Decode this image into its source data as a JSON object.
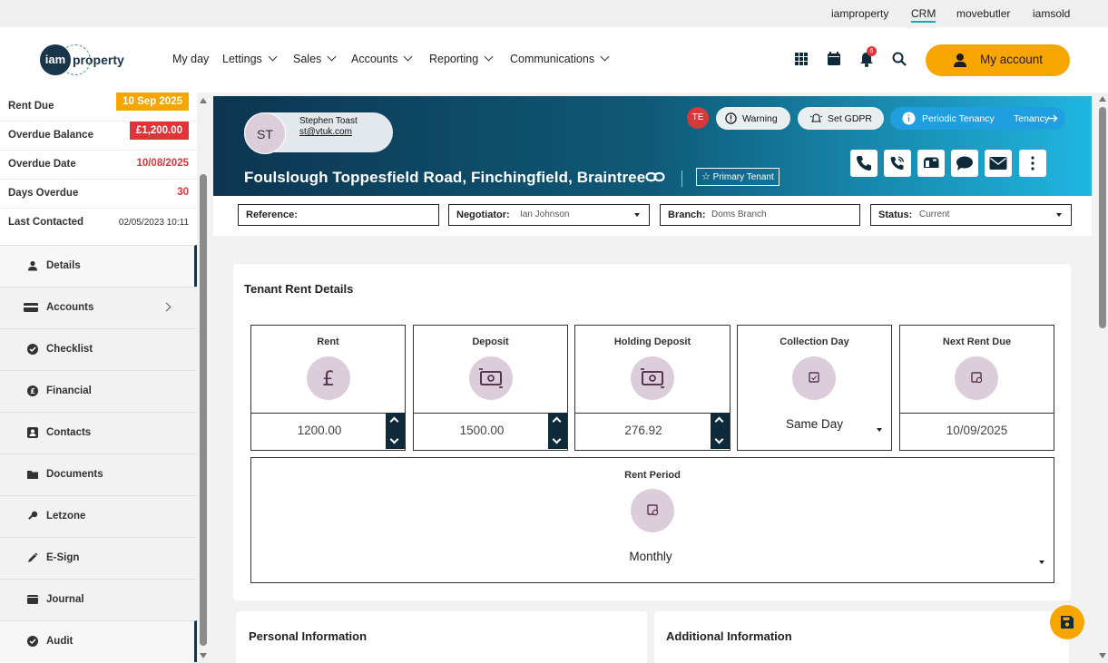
{
  "top_links": [
    "iamproperty",
    "CRM",
    "movebutler",
    "iamsold"
  ],
  "top_links_active": "CRM",
  "logo": {
    "mark": "iam",
    "word": "property"
  },
  "nav": {
    "items": [
      "My day",
      "Lettings",
      "Sales",
      "Accounts",
      "Reporting",
      "Communications"
    ]
  },
  "header": {
    "notification_count": "6",
    "my_account_label": "My account"
  },
  "summary": {
    "rent_due_label": "Rent Due",
    "rent_due_value": "10 Sep 2025",
    "overdue_balance_label": "Overdue Balance",
    "overdue_balance_value": "£1,200.00",
    "overdue_date_label": "Overdue Date",
    "overdue_date_value": "10/08/2025",
    "days_overdue_label": "Days Overdue",
    "days_overdue_value": "30",
    "last_contacted_label": "Last Contacted",
    "last_contacted_value": "02/05/2023 10:11"
  },
  "sidebar": {
    "items": [
      {
        "label": "Details",
        "icon": "user-icon"
      },
      {
        "label": "Accounts",
        "icon": "card-icon"
      },
      {
        "label": "Checklist",
        "icon": "check-circle-icon"
      },
      {
        "label": "Financial",
        "icon": "pound-circle-icon"
      },
      {
        "label": "Contacts",
        "icon": "contact-icon"
      },
      {
        "label": "Documents",
        "icon": "folder-icon"
      },
      {
        "label": "Letzone",
        "icon": "key-icon"
      },
      {
        "label": "E-Sign",
        "icon": "pen-icon"
      },
      {
        "label": "Journal",
        "icon": "journal-icon"
      },
      {
        "label": "Audit",
        "icon": "check-circle-icon"
      }
    ],
    "active": "Details"
  },
  "contact": {
    "initials": "ST",
    "name": "Stephen Toast",
    "email": "st@vtuk.com",
    "address": "Foulslough Toppesfield Road, Finchingfield, Braintree",
    "primary_tenant_label": "Primary Tenant",
    "user_initials": "TE",
    "warning_label": "Warning",
    "gdpr_label": "Set GDPR",
    "tenancy_type_label": "Periodic Tenancy",
    "tenancy_link_label": "Tenancy"
  },
  "fields": {
    "reference_label": "Reference:",
    "reference_value": "",
    "negotiator_label": "Negotiator:",
    "negotiator_value": "Ian Johnson",
    "branch_label": "Branch:",
    "branch_value": "Doms Branch",
    "status_label": "Status:",
    "status_value": "Current"
  },
  "rent_details": {
    "title": "Tenant Rent Details",
    "rent_label": "Rent",
    "rent_value": "1200.00",
    "deposit_label": "Deposit",
    "deposit_value": "1500.00",
    "holding_label": "Holding Deposit",
    "holding_value": "276.92",
    "collection_label": "Collection Day",
    "collection_value": "Same Day",
    "next_due_label": "Next Rent Due",
    "next_due_value": "10/09/2025",
    "period_label": "Rent Period",
    "period_value": "Monthly"
  },
  "sections": {
    "personal": "Personal Information",
    "additional": "Additional Information"
  },
  "colors": {
    "accent": "#f7a600",
    "navy": "#0e2a3b",
    "danger": "#e0333a",
    "banner_start": "#0c3550",
    "banner_end": "#1fb6e0"
  }
}
